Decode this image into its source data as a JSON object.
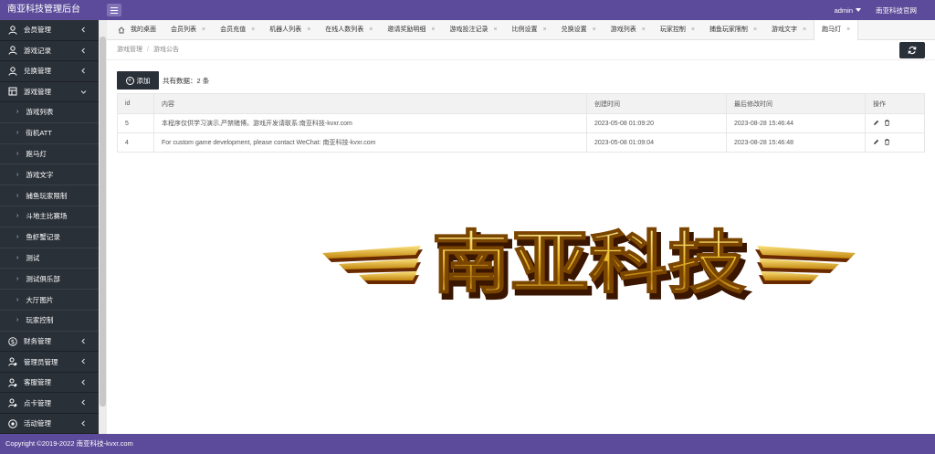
{
  "app": {
    "title": "南亚科技管理后台"
  },
  "topbar": {
    "user": "admin",
    "site_link": "南亚科技官网"
  },
  "sidebar": {
    "groups_top": [
      {
        "label": "会员管理",
        "icon": "user-icon"
      },
      {
        "label": "游戏记录",
        "icon": "user-icon"
      },
      {
        "label": "兑换管理",
        "icon": "user-icon"
      },
      {
        "label": "游戏管理",
        "icon": "game-icon"
      }
    ],
    "sub_items": [
      "游戏列表",
      "街机ATT",
      "跑马灯",
      "游戏文字",
      "捕鱼玩家限制",
      "斗地主比赛场",
      "鱼虾蟹记录",
      "测试",
      "测试俱乐部",
      "大厅图片",
      "玩家控制"
    ],
    "groups_bottom": [
      {
        "label": "财务管理",
        "icon": "dollar-icon"
      },
      {
        "label": "管理员管理",
        "icon": "admin-icon"
      },
      {
        "label": "客服管理",
        "icon": "admin-icon"
      },
      {
        "label": "点卡管理",
        "icon": "admin-icon"
      },
      {
        "label": "活动管理",
        "icon": "activity-icon"
      }
    ]
  },
  "tabs": [
    {
      "label": "我的桌面",
      "closable": false
    },
    {
      "label": "会员列表",
      "closable": true
    },
    {
      "label": "会员充值",
      "closable": true
    },
    {
      "label": "机器人列表",
      "closable": true
    },
    {
      "label": "在线人数列表",
      "closable": true
    },
    {
      "label": "邀请奖励明细",
      "closable": true
    },
    {
      "label": "游戏投注记录",
      "closable": true
    },
    {
      "label": "比例设置",
      "closable": true
    },
    {
      "label": "兑换设置",
      "closable": true
    },
    {
      "label": "游戏列表",
      "closable": true
    },
    {
      "label": "玩家控制",
      "closable": true
    },
    {
      "label": "捕鱼玩家限制",
      "closable": true
    },
    {
      "label": "游戏文字",
      "closable": true
    },
    {
      "label": "跑马灯",
      "closable": true,
      "active": true
    }
  ],
  "tab_close_glyph": "×",
  "breadcrumb": {
    "parent": "游戏管理",
    "sep": "/",
    "current": "游戏公告"
  },
  "toolbar": {
    "add_label": "添加",
    "add_glyph": "+",
    "count_text": "共有数据：2 条"
  },
  "table": {
    "headers": [
      "id",
      "内容",
      "创建时间",
      "最后修改时间",
      "操作"
    ],
    "rows": [
      {
        "id": "5",
        "content": "本程序仅供学习演示,严禁赌博。游戏开发请联系:南亚科技-kvxr.com",
        "created": "2023-05-08 01:09:20",
        "updated": "2023-08-28 15:46:44"
      },
      {
        "id": "4",
        "content": "For custom game development, please contact WeChat: 南亚科技-kvxr.com",
        "created": "2023-05-08 01:09:04",
        "updated": "2023-08-28 15:46:48"
      }
    ]
  },
  "logo": {
    "text": "南亚科技"
  },
  "footer": {
    "copyright": "Copyright ©2019-2022 南亚科技-kvxr.com"
  },
  "colors": {
    "header": "#5b4b9a",
    "sidebar": "#2a3038",
    "dark_button": "#2a3038"
  }
}
